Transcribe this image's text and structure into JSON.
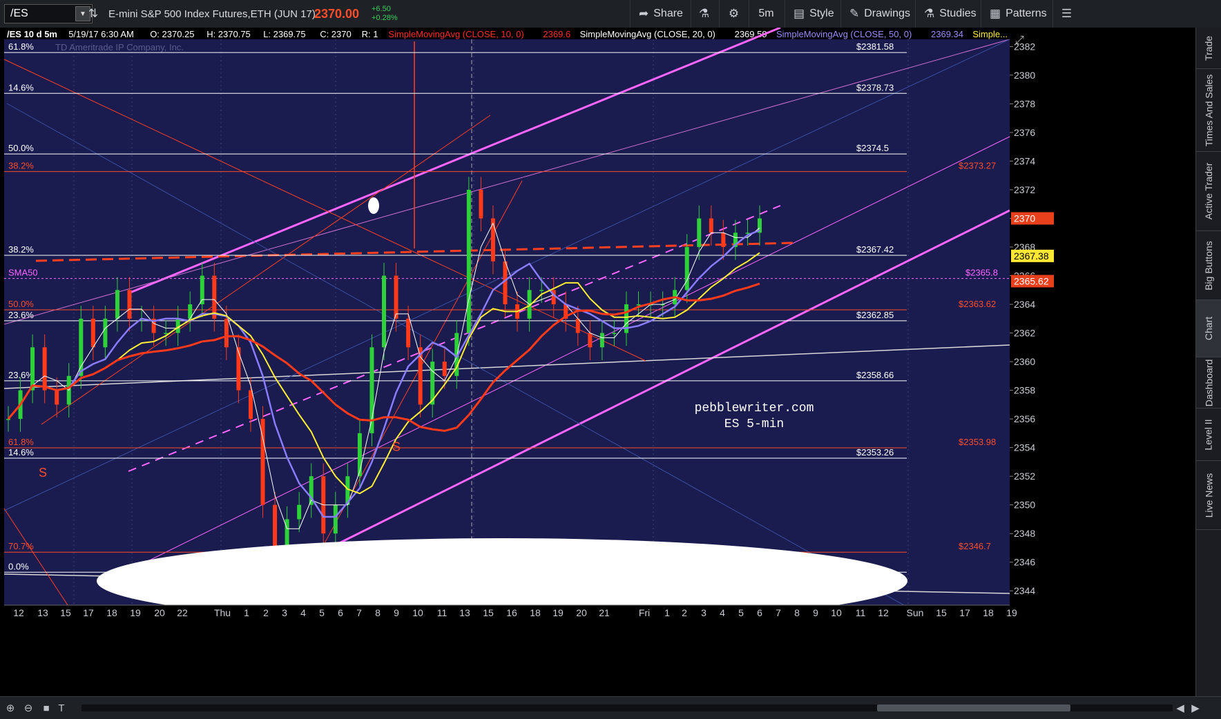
{
  "toolbar": {
    "symbol": "/ES",
    "description": "E-mini S&P 500 Index Futures,ETH (JUN 17)",
    "last_price": "2370.00",
    "net_change": "+6.50",
    "pct_change": "+0.28%",
    "share_label": "Share",
    "timeframe_label": "5m",
    "style_label": "Style",
    "drawings_label": "Drawings",
    "studies_label": "Studies",
    "patterns_label": "Patterns"
  },
  "sidebar": {
    "tabs": [
      "Trade",
      "Times And Sales",
      "Active Trader",
      "Big Buttons",
      "Chart",
      "Dashboard",
      "Level II",
      "Live News"
    ],
    "active": "Chart"
  },
  "chart_data": {
    "type": "candlestick",
    "header": {
      "symbol_period": "/ES 10 d 5m",
      "datetime": "5/19/17 6:30 AM",
      "open": "O: 2370.25",
      "high": "H: 2370.75",
      "low": "L: 2369.75",
      "close": "C: 2370",
      "range": "R: 1",
      "studies": [
        {
          "label": "SimpleMovingAvg (CLOSE, 10, 0)",
          "value": "2369.6",
          "color": "#ff2a2a"
        },
        {
          "label": "SimpleMovingAvg (CLOSE, 20, 0)",
          "value": "2369.59",
          "color": "#ffffff"
        },
        {
          "label": "SimpleMovingAvg (CLOSE, 50, 0)",
          "value": "2369.34",
          "color": "#9a8cff"
        },
        {
          "label": "Simple...",
          "value": "",
          "color": "#ffee33"
        }
      ]
    },
    "watermark": "TD Ameritrade IP Company, Inc.",
    "annotation": "pebblewriter.com\nES 5-min",
    "y_axis": {
      "min": 2343,
      "max": 2382.5,
      "ticks": [
        2344,
        2346,
        2348,
        2350,
        2352,
        2354,
        2356,
        2358,
        2360,
        2362,
        2364,
        2366,
        2368,
        2370,
        2372,
        2374,
        2376,
        2378,
        2380,
        2382
      ]
    },
    "x_axis_labels": [
      "12",
      "13",
      "15",
      "17",
      "18",
      "19",
      "20",
      "22",
      "Thu",
      "1",
      "2",
      "3",
      "4",
      "5",
      "6",
      "7",
      "8",
      "9",
      "10",
      "11",
      "13",
      "15",
      "16",
      "18",
      "19",
      "20",
      "21",
      "Fri",
      "1",
      "2",
      "3",
      "4",
      "5",
      "6",
      "7",
      "8",
      "9",
      "10",
      "11",
      "12",
      "Sun",
      "15",
      "17",
      "18",
      "19"
    ],
    "price_tags": [
      {
        "value": 2370.0,
        "label": "2370",
        "bg": "#e8401c",
        "fg": "#ffffff"
      },
      {
        "value": 2367.38,
        "label": "2367.38",
        "bg": "#ffe833",
        "fg": "#000000"
      },
      {
        "value": 2365.62,
        "label": "2365.62",
        "bg": "#e8401c",
        "fg": "#ffffff"
      }
    ],
    "levels": [
      {
        "price": 2381.58,
        "label": "$2381.58",
        "color": "#ffffff",
        "left_label": "61.8%"
      },
      {
        "price": 2378.73,
        "label": "$2378.73",
        "color": "#ffffff",
        "left_label": "14.6%"
      },
      {
        "price": 2374.5,
        "label": "$2374.5",
        "color": "#ffffff",
        "left_label": "50.0%"
      },
      {
        "price": 2373.27,
        "label": "$2373.27",
        "color": "#ff4d2a",
        "left_label": "38.2%"
      },
      {
        "price": 2367.42,
        "label": "$2367.42",
        "color": "#ffffff",
        "left_label": "38.2%"
      },
      {
        "price": 2365.8,
        "label": "$2365.8",
        "color": "#ff66ff",
        "left_label": "SMA50",
        "dashed": true
      },
      {
        "price": 2363.62,
        "label": "$2363.62",
        "color": "#ff4d2a",
        "left_label": "50.0%"
      },
      {
        "price": 2362.85,
        "label": "$2362.85",
        "color": "#ffffff",
        "left_label": "23.6%"
      },
      {
        "price": 2358.66,
        "label": "$2358.66",
        "color": "#ffffff",
        "left_label": "23.6%"
      },
      {
        "price": 2353.98,
        "label": "$2353.98",
        "color": "#ff4d2a",
        "left_label": "61.8%"
      },
      {
        "price": 2353.26,
        "label": "$2353.26",
        "color": "#ffffff",
        "left_label": "14.6%"
      },
      {
        "price": 2346.7,
        "label": "$2346.7",
        "color": "#ff4d2a",
        "left_label": "70.7%"
      },
      {
        "price": 2345.3,
        "label": "",
        "color": "#ffffff",
        "left_label": "0.0%"
      }
    ],
    "s_markers": [
      {
        "label": "S",
        "x_label": "13",
        "price": 2352.2
      },
      {
        "label": "S",
        "x_label": "9",
        "price": 2354.0
      }
    ],
    "close_path": [
      2356,
      2358,
      2361,
      2358,
      2357,
      2359,
      2363,
      2361,
      2363,
      2365,
      2363,
      2363,
      2362,
      2362,
      2363,
      2364,
      2366,
      2363,
      2361,
      2358,
      2356,
      2350,
      2346,
      2349,
      2350,
      2352,
      2348,
      2350,
      2352,
      2355,
      2361,
      2366,
      2363,
      2361,
      2357,
      2360,
      2359,
      2362,
      2372,
      2370,
      2367,
      2364,
      2363,
      2365,
      2365,
      2364,
      2363,
      2362,
      2361,
      2362,
      2362,
      2364,
      2364,
      2364,
      2364,
      2365,
      2368,
      2370,
      2369,
      2368,
      2369,
      2369,
      2370
    ]
  }
}
